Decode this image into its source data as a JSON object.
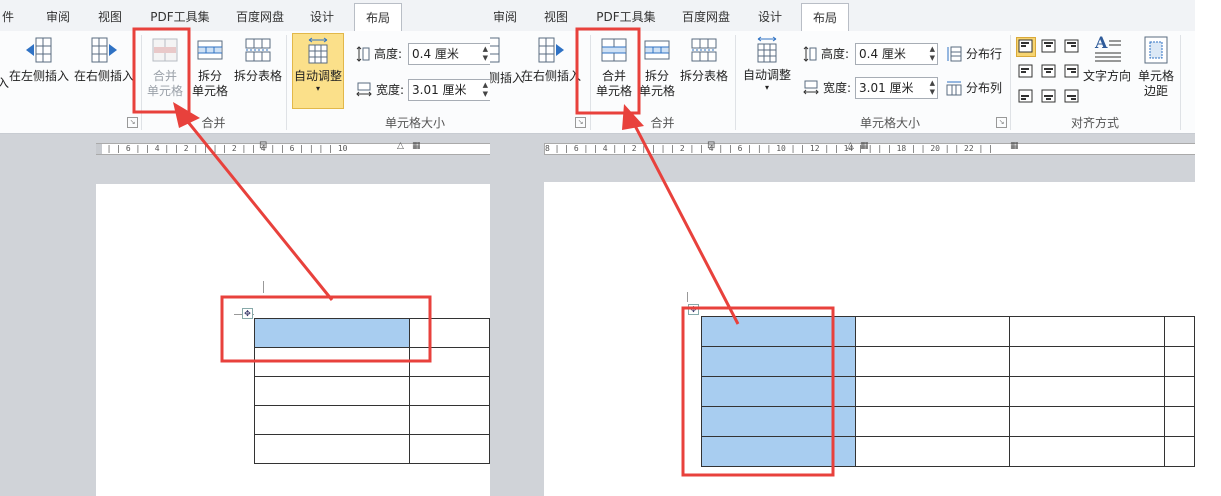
{
  "left_panel": {
    "tabs": [
      {
        "label": "件"
      },
      {
        "label": "审阅"
      },
      {
        "label": "视图"
      },
      {
        "label": "PDF工具集"
      },
      {
        "label": "百度网盘"
      },
      {
        "label": "设计"
      },
      {
        "label": "布局"
      }
    ],
    "active_tab": "布局",
    "buttons": {
      "insert_left_partial": "入",
      "insert_left": "在左侧插入",
      "insert_right": "在右侧插入",
      "merge_cells_line1": "合并",
      "merge_cells_line2": "单元格",
      "split_cells_line1": "拆分",
      "split_cells_line2": "单元格",
      "split_table": "拆分表格",
      "autofit": "自动调整"
    },
    "groups": {
      "merge": "合并",
      "cell_size": "单元格大小"
    },
    "height": {
      "label": "高度:",
      "value": "0.4 厘米"
    },
    "width": {
      "label": "宽度:",
      "value": "3.01 厘米"
    },
    "ruler_text": "8 | | 6 | | 4 | | 2 | |  | | 2 | | 4 | | 6 | |   | | 10"
  },
  "right_panel": {
    "tabs": [
      {
        "label": "审阅"
      },
      {
        "label": "视图"
      },
      {
        "label": "PDF工具集"
      },
      {
        "label": "百度网盘"
      },
      {
        "label": "设计"
      },
      {
        "label": "布局"
      }
    ],
    "active_tab": "布局",
    "buttons": {
      "insert_left_partial": "侧插入",
      "insert_right": "在右侧插入",
      "merge_cells_line1": "合并",
      "merge_cells_line2": "单元格",
      "split_cells_line1": "拆分",
      "split_cells_line2": "单元格",
      "split_table": "拆分表格",
      "autofit": "自动调整",
      "distribute_rows": "分布行",
      "distribute_cols": "分布列",
      "text_direction": "文字方向",
      "cell_margin_line1": "单元格",
      "cell_margin_line2": "边距"
    },
    "groups": {
      "merge": "合并",
      "cell_size": "单元格大小",
      "alignment": "对齐方式"
    },
    "height": {
      "label": "高度:",
      "value": "0.4 厘米"
    },
    "width": {
      "label": "宽度:",
      "value": "3.01 厘米"
    },
    "ruler_text": "8 | | 6 | | 4 | | 2 | |  | | 2 | | 4 | | 6 | |   | 10 | | 12 | | 14 | |   | | 18 | | 20 | | 22 | |"
  },
  "colors": {
    "annotation": "#e8413c",
    "selection": "#a8cdf0",
    "autofit_highlight": "#fbe08a",
    "active_align": "#f7d470"
  },
  "icons": [
    "insert-left-icon",
    "insert-right-icon",
    "merge-cells-icon",
    "split-cells-icon",
    "split-table-icon",
    "autofit-icon",
    "height-icon",
    "width-icon",
    "distribute-rows-icon",
    "distribute-cols-icon",
    "align-icon",
    "text-direction-icon",
    "cell-margin-icon",
    "table-move-icon",
    "dialog-launcher-icon"
  ]
}
